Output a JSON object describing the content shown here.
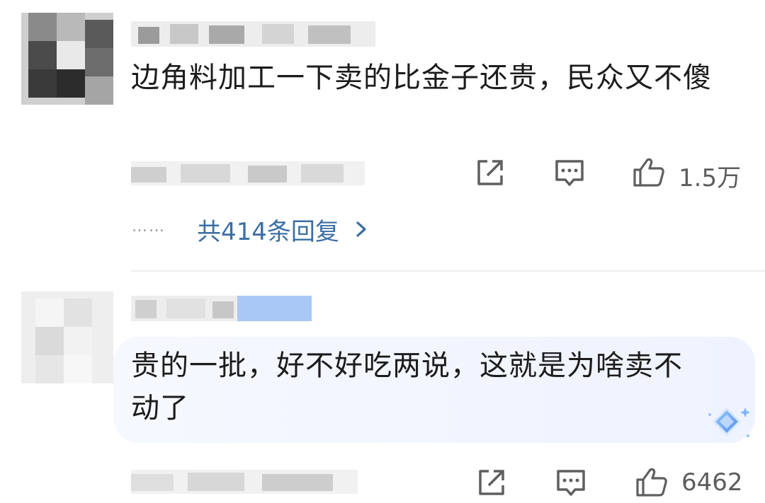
{
  "comments": [
    {
      "text": "边角料加工一下卖的比金子还贵，民众又不傻",
      "likes": "1.5万",
      "replies_label": "共414条回复",
      "replies_ellipsis": "……"
    },
    {
      "text": "贵的一批，好不好吃两说，这就是为啥卖不动了",
      "likes": "6462"
    }
  ],
  "icons": [
    "share-icon",
    "comment-icon",
    "like-icon",
    "chevron-right-icon",
    "sparkle-icon"
  ],
  "colors": {
    "link": "#3b6fa3",
    "muted": "#5d5d5d",
    "divider": "#ececec",
    "bubble": "#eef3ff"
  }
}
